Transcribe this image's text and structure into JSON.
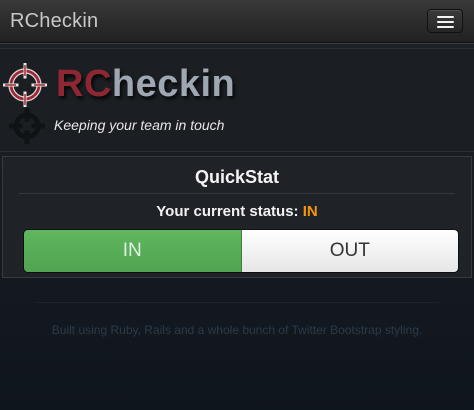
{
  "navbar": {
    "brand": "RCheckin",
    "menu_icon": "hamburger-menu-icon"
  },
  "header": {
    "logo_icon": "crosshair-icon",
    "logo_rc": "RC",
    "logo_checkin": "heckin",
    "tagline": "Keeping your team in touch",
    "colors": {
      "logo_rc": "#8f2733",
      "logo_checkin": "#9ea7b2"
    }
  },
  "quickstat": {
    "title": "QuickStat",
    "status_label": "Your current status:",
    "status_value": "IN",
    "in_button": "IN",
    "out_button": "OUT",
    "selected": "IN",
    "colors": {
      "status_value": "#f89406",
      "in_active": "#5bb75b",
      "out_inactive": "#f5f5f5"
    }
  },
  "footer": {
    "text": "Built using Ruby, Rails and a whole bunch of Twitter Bootstrap styling."
  }
}
